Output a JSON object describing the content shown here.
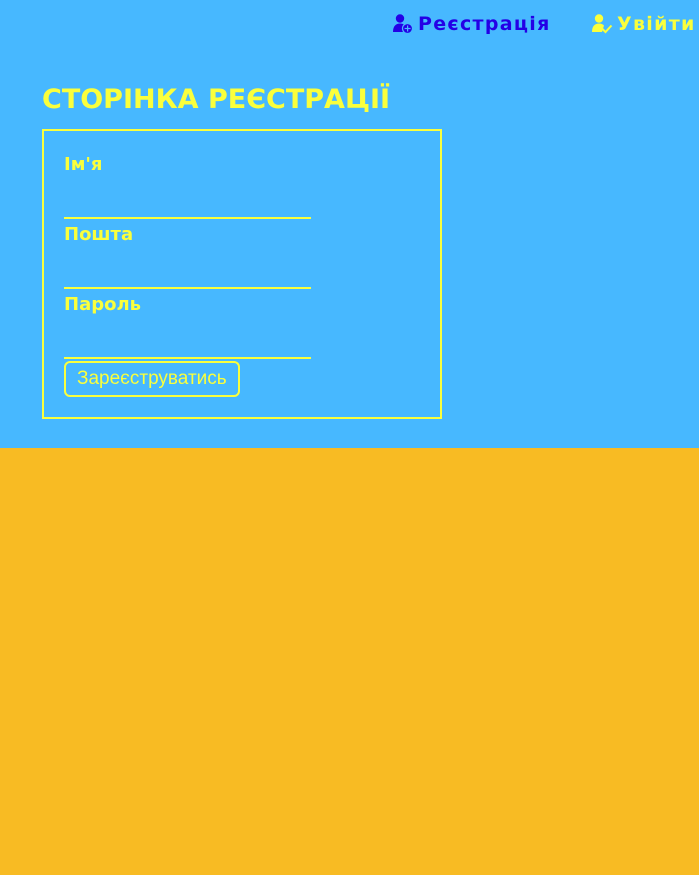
{
  "colors": {
    "top_background": "#47b8ff",
    "bottom_background": "#f8bb23",
    "accent_yellow": "#faff3c",
    "register_link": "#2400e6"
  },
  "nav": {
    "register": {
      "label": "Реєстрація",
      "icon": "user-plus-icon"
    },
    "login": {
      "label": "Увійти",
      "icon": "user-check-icon"
    }
  },
  "page_title": "СТОРІНКА РЕЄСТРАЦІЇ",
  "form": {
    "name": {
      "label": "Ім'я",
      "value": "",
      "placeholder": ""
    },
    "email": {
      "label": "Пошта",
      "value": "",
      "placeholder": ""
    },
    "password": {
      "label": "Пароль",
      "value": "",
      "placeholder": ""
    },
    "submit_label": "Зареєструватись"
  }
}
